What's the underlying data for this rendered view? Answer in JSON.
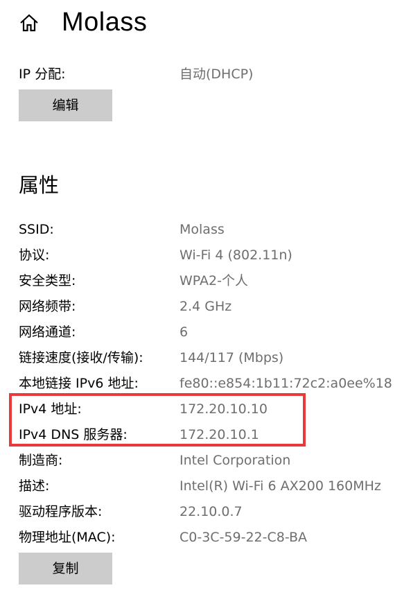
{
  "header": {
    "home_icon": "home-icon",
    "title": "Molass"
  },
  "ip_assignment": {
    "label": "IP 分配:",
    "value": "自动(DHCP)",
    "edit_button": "编辑"
  },
  "properties": {
    "heading": "属性",
    "rows": [
      {
        "label": "SSID:",
        "value": "Molass"
      },
      {
        "label": "协议:",
        "value": "Wi-Fi 4 (802.11n)"
      },
      {
        "label": "安全类型:",
        "value": "WPA2-个人"
      },
      {
        "label": "网络频带:",
        "value": "2.4 GHz"
      },
      {
        "label": "网络通道:",
        "value": "6"
      },
      {
        "label": "链接速度(接收/传输):",
        "value": "144/117 (Mbps)"
      },
      {
        "label": "本地链接 IPv6 地址:",
        "value": "fe80::e854:1b11:72c2:a0ee%18"
      },
      {
        "label": "IPv4 地址:",
        "value": "172.20.10.10"
      },
      {
        "label": "IPv4 DNS 服务器:",
        "value": "172.20.10.1"
      },
      {
        "label": "制造商:",
        "value": "Intel Corporation"
      },
      {
        "label": "描述:",
        "value": "Intel(R) Wi-Fi 6 AX200 160MHz"
      },
      {
        "label": "驱动程序版本:",
        "value": "22.10.0.7"
      },
      {
        "label": "物理地址(MAC):",
        "value": "C0-3C-59-22-C8-BA"
      }
    ],
    "copy_button": "复制"
  },
  "colors": {
    "highlight": "#e8393d",
    "button_bg": "#cccccc",
    "value_text": "#6e6e6e"
  }
}
